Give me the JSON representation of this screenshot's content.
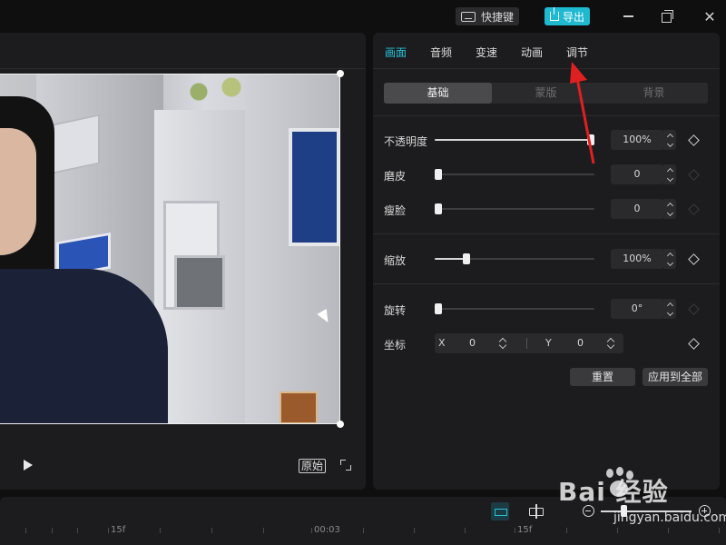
{
  "titlebar": {
    "shortcut_label": "快捷键",
    "export_label": "导出",
    "close_glyph": "✕",
    "accent": "#1fb9d0"
  },
  "player": {
    "ratio_label": "原始"
  },
  "props": {
    "tabs": [
      {
        "label": "画面",
        "active": true
      },
      {
        "label": "音频",
        "active": false
      },
      {
        "label": "变速",
        "active": false
      },
      {
        "label": "动画",
        "active": false
      },
      {
        "label": "调节",
        "active": false
      }
    ],
    "segments": [
      {
        "label": "基础",
        "active": true
      },
      {
        "label": "蒙版",
        "active": false
      },
      {
        "label": "背景",
        "active": false
      }
    ],
    "rows": {
      "opacity": {
        "label": "不透明度",
        "value": "100%",
        "level": 1.0
      },
      "smooth": {
        "label": "磨皮",
        "value": "0",
        "level": 0.0
      },
      "slim": {
        "label": "瘦脸",
        "value": "0",
        "level": 0.0
      },
      "scale": {
        "label": "缩放",
        "value": "100%",
        "level": 0.2
      },
      "rotate": {
        "label": "旋转",
        "value": "0°",
        "level": 0.0
      }
    },
    "position": {
      "label": "坐标",
      "x_label": "X",
      "x_value": "0",
      "y_label": "Y",
      "y_value": "0"
    },
    "reset_label": "重置",
    "apply_all_label": "应用到全部",
    "active_tab_color": "#21c3d9",
    "arrow_color": "#e02020"
  },
  "timeline": {
    "ruler_labels": [
      "15f",
      "00:03",
      "15f"
    ]
  },
  "watermark": {
    "brand_text": "Bai 经验",
    "url": "jingyan.baidu.com"
  }
}
